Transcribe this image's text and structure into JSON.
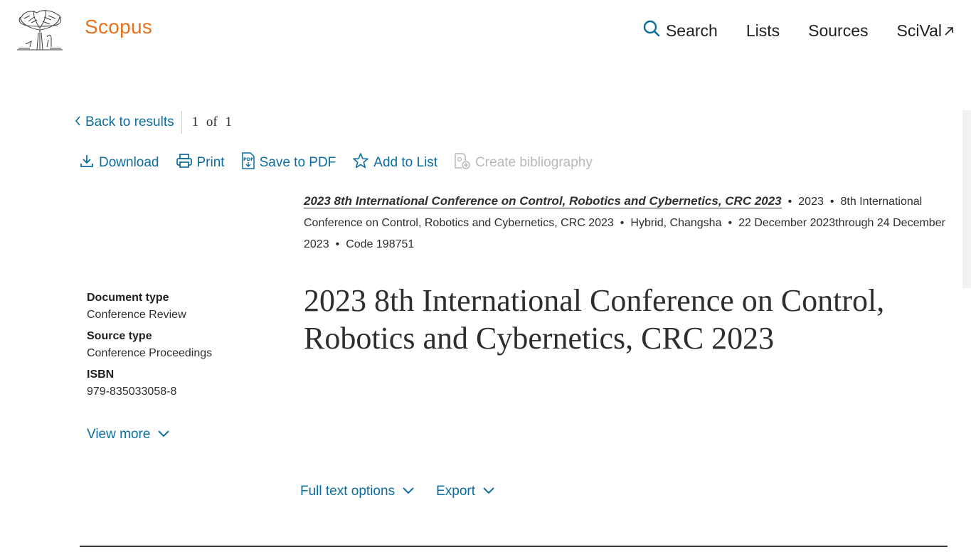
{
  "header": {
    "brand": "Scopus",
    "nav": {
      "search": "Search",
      "lists": "Lists",
      "sources": "Sources",
      "scival": "SciVal"
    }
  },
  "navigation": {
    "back_label": "Back to results",
    "position_current": "1",
    "position_of": "of",
    "position_total": "1"
  },
  "actions": {
    "download": "Download",
    "print": "Print",
    "save_pdf": "Save to PDF",
    "add_list": "Add to List",
    "bibliography": "Create bibliography"
  },
  "source": {
    "title_link": "2023 8th International Conference on Control, Robotics and Cybernetics, CRC 2023",
    "year": "2023",
    "conference_name": "8th International Conference on Control, Robotics and Cybernetics, CRC 2023",
    "location": "Hybrid, Changsha",
    "dates": "22 December 2023through 24 December 2023",
    "code": "Code 198751"
  },
  "metadata": {
    "document_type_label": "Document type",
    "document_type_value": "Conference Review",
    "source_type_label": "Source type",
    "source_type_value": "Conference Proceedings",
    "isbn_label": "ISBN",
    "isbn_value": "979-835033058-8",
    "view_more": "View more"
  },
  "document": {
    "title": "2023 8th International Conference on Control, Robotics and Cybernetics, CRC 2023"
  },
  "options": {
    "full_text": "Full text options",
    "export": "Export"
  },
  "colors": {
    "brand": "#e9711c",
    "link": "#0c6d9f",
    "disabled": "#b9b9b9",
    "text": "#2e2e2e"
  }
}
